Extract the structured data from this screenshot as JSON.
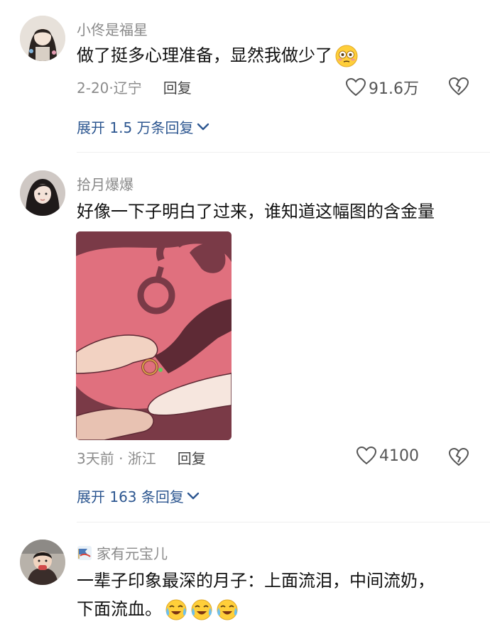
{
  "comments": [
    {
      "username": "小佟是福星",
      "text": "做了挺多心理准备，显然我做少了",
      "date_location": "2-20·辽宁",
      "reply_label": "回复",
      "likes": "91.6万",
      "expand_label": "展开 1.5 万条回复"
    },
    {
      "username": "拾月爆爆",
      "text": "好像一下子明白了过来，谁知道这幅图的含金量",
      "date_location": "3天前 · 浙江",
      "reply_label": "回复",
      "likes": "4100",
      "expand_label": "展开 163 条回复"
    },
    {
      "username": "家有元宝儿",
      "text_line1": "一辈子印象最深的月子：上面流泪，中间流奶，",
      "text_line2": "下面流血。"
    }
  ],
  "colors": {
    "link_blue": "#2c5690",
    "meta_gray": "#8c8c8c",
    "image_pink": "#e0707e",
    "image_maroon": "#7a3a47"
  }
}
